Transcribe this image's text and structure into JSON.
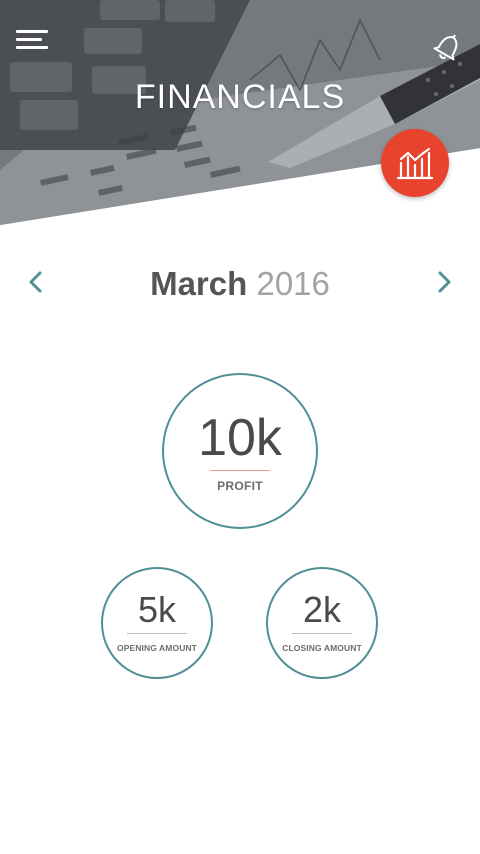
{
  "header": {
    "title": "FINANCIALS",
    "menu_icon": "hamburger-menu-icon",
    "notification_icon": "bell-icon",
    "action_icon": "bar-chart-icon",
    "action_color": "#e8432d"
  },
  "month_selector": {
    "month": "March",
    "year": "2016",
    "prev_icon": "chevron-left-icon",
    "next_icon": "chevron-right-icon",
    "arrow_color": "#4f8f95"
  },
  "stats": {
    "profit": {
      "value": "10k",
      "label": "PROFIT"
    },
    "opening": {
      "value": "5k",
      "label": "OPENING AMOUNT"
    },
    "closing": {
      "value": "2k",
      "label": "CLOSING AMOUNT"
    },
    "ring_color": "#4f8f95"
  }
}
